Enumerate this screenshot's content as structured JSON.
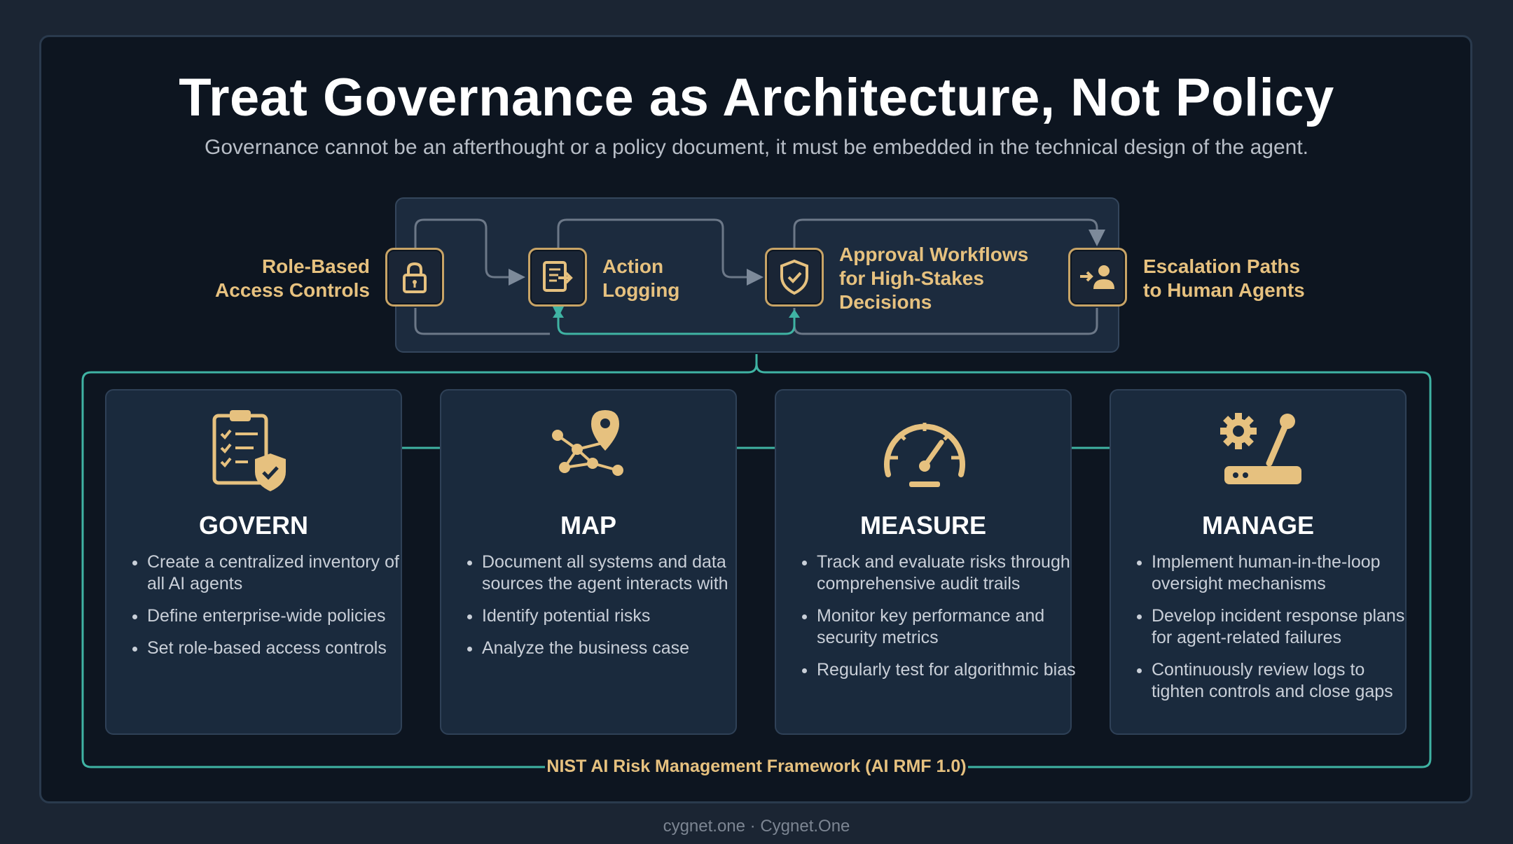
{
  "title": "Treat Governance as Architecture, Not Policy",
  "subtitle": "Governance cannot be an afterthought or a policy document, it must be embedded in the technical design of the agent.",
  "flow": {
    "steps": [
      {
        "label": "Role-Based\nAccess Controls",
        "icon": "lock-icon"
      },
      {
        "label": "Action\nLogging",
        "icon": "document-arrow-icon"
      },
      {
        "label": "Approval Workflows\nfor High-Stakes\nDecisions",
        "icon": "shield-check-icon"
      },
      {
        "label": "Escalation Paths\nto Human Agents",
        "icon": "person-arrow-icon"
      }
    ]
  },
  "pillars": [
    {
      "title": "GOVERN",
      "icon": "clipboard-shield-icon",
      "items": [
        "Create a centralized inventory of all AI agents",
        "Define enterprise-wide policies",
        "Set role-based access controls"
      ]
    },
    {
      "title": "MAP",
      "icon": "network-pin-icon",
      "items": [
        "Document all systems and data sources the agent interacts with",
        "Identify potential risks",
        "Analyze the business case"
      ]
    },
    {
      "title": "MEASURE",
      "icon": "gauge-icon",
      "items": [
        "Track and evaluate risks through comprehensive audit trails",
        "Monitor key performance and security metrics",
        "Regularly test for algorithmic bias"
      ]
    },
    {
      "title": "MANAGE",
      "icon": "gear-lever-icon",
      "items": [
        "Implement human-in-the-loop oversight mechanisms",
        "Develop incident response plans for agent-related failures",
        "Continuously review logs to tighten controls and close gaps"
      ]
    }
  ],
  "framework_label": "NIST AI Risk Management Framework (AI RMF 1.0)",
  "footer": "cygnet.one · Cygnet.One",
  "colors": {
    "gold": "#e6c17f",
    "teal": "#3fb3a3",
    "background": "#0d1520",
    "card": "#1a2a3d"
  }
}
